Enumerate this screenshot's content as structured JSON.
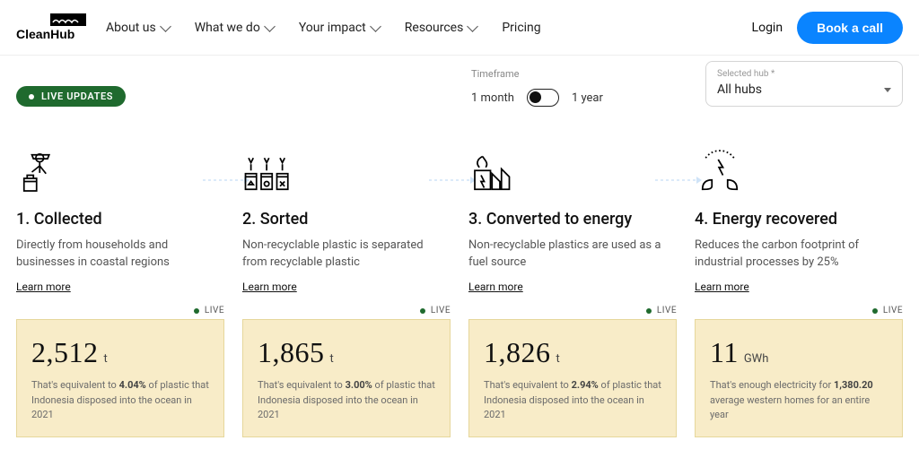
{
  "brand": "CleanHub",
  "nav": {
    "about": "About us",
    "what": "What we do",
    "impact": "Your impact",
    "resources": "Resources",
    "pricing": "Pricing",
    "login": "Login",
    "cta": "Book a call"
  },
  "badge": "LIVE UPDATES",
  "timeframe": {
    "label": "Timeframe",
    "opt1": "1 month",
    "opt2": "1 year"
  },
  "hub": {
    "label": "Selected hub *",
    "value": "All hubs"
  },
  "live": "LIVE",
  "steps": [
    {
      "title": "1. Collected",
      "desc": "Directly from households and businesses in coastal regions",
      "learn": "Learn more",
      "value": "2,512",
      "unit": "t",
      "eq_pre": "That's equivalent to ",
      "eq_bold": "4.04%",
      "eq_post": " of plastic that Indonesia disposed into the ocean in 2021"
    },
    {
      "title": "2. Sorted",
      "desc": "Non-recyclable plastic is separated from recyclable plastic",
      "learn": "Learn more",
      "value": "1,865",
      "unit": "t",
      "eq_pre": "That's equivalent to ",
      "eq_bold": "3.00%",
      "eq_post": " of plastic that Indonesia disposed into the ocean in 2021"
    },
    {
      "title": "3. Converted to energy",
      "desc": "Non-recyclable plastics are used as a fuel source",
      "learn": "Learn more",
      "value": "1,826",
      "unit": "t",
      "eq_pre": "That's equivalent to ",
      "eq_bold": "2.94%",
      "eq_post": " of plastic that Indonesia disposed into the ocean in 2021"
    },
    {
      "title": "4. Energy recovered",
      "desc": "Reduces the carbon footprint of industrial processes by 25%",
      "learn": "Learn more",
      "value": "11",
      "unit": "GWh",
      "eq_pre": "That's enough electricity for ",
      "eq_bold": "1,380.20",
      "eq_post": " average western homes for an entire year"
    }
  ]
}
